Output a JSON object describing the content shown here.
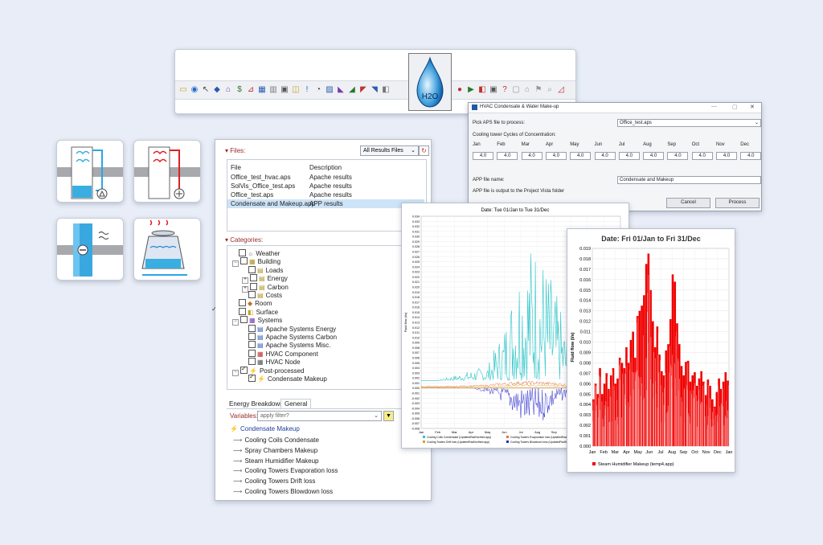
{
  "toolbar": {
    "icons": [
      "open-folder",
      "help",
      "cursor",
      "cube",
      "zone",
      "dollar",
      "chart",
      "table",
      "bar-chart",
      "calculator",
      "results",
      "exclamation",
      "pie",
      "image",
      "chart-a",
      "chart-b",
      "chart-c",
      "chart-d",
      "chart-e"
    ],
    "icons_right": [
      "stop",
      "play",
      "pause",
      "save",
      "question",
      "lock",
      "house",
      "flag",
      "search",
      "ruler"
    ],
    "drop_icon_label": "H2O"
  },
  "symbols": [
    "cooling-coil-icon",
    "heating-coil-icon",
    "steam-humidifier-icon",
    "cooling-tower-icon"
  ],
  "files_panel": {
    "title": "Files:",
    "filter_select": "All Results Files",
    "columns": [
      "File",
      "Description"
    ],
    "rows": [
      {
        "file": "Office_test_hvac.aps",
        "desc": "Apache results"
      },
      {
        "file": "SolVis_Office_test.aps",
        "desc": "Apache results"
      },
      {
        "file": "Office_test.aps",
        "desc": "Apache results"
      },
      {
        "file": "Condensate and Makeup.app",
        "desc": "APP results"
      }
    ],
    "categories_title": "Categories:",
    "tree": [
      {
        "label": "Weather",
        "level": 1,
        "expander": false,
        "checked": false
      },
      {
        "label": "Building",
        "level": 1,
        "expander": true,
        "checked": false
      },
      {
        "label": "Loads",
        "level": 2,
        "expander": false,
        "checked": false
      },
      {
        "label": "Energy",
        "level": 2,
        "expander": true,
        "checked": false
      },
      {
        "label": "Carbon",
        "level": 2,
        "expander": true,
        "checked": false
      },
      {
        "label": "Costs",
        "level": 2,
        "expander": false,
        "checked": false
      },
      {
        "label": "Room",
        "level": 1,
        "expander": false,
        "checked": false
      },
      {
        "label": "Surface",
        "level": 1,
        "expander": false,
        "checked": false
      },
      {
        "label": "Systems",
        "level": 1,
        "expander": true,
        "checked": false
      },
      {
        "label": "Apache Systems Energy",
        "level": 2,
        "expander": false,
        "checked": false
      },
      {
        "label": "Apache Systems Carbon",
        "level": 2,
        "expander": false,
        "checked": false
      },
      {
        "label": "Apache Systems Misc.",
        "level": 2,
        "expander": false,
        "checked": false
      },
      {
        "label": "HVAC Component",
        "level": 2,
        "expander": false,
        "checked": false
      },
      {
        "label": "HVAC Node",
        "level": 2,
        "expander": false,
        "checked": false
      },
      {
        "label": "Post-processed",
        "level": 1,
        "expander": true,
        "checked": true
      },
      {
        "label": "Condensate Makeup",
        "level": 2,
        "expander": false,
        "checked": true
      }
    ],
    "tabs": [
      "Energy Breakdown",
      "General"
    ],
    "variables_label": "Variables:",
    "filter_placeholder": "apply filter?",
    "var_group": "Condensate Makeup",
    "variables": [
      "Cooling Coils Condensate",
      "Spray Chambers Makeup",
      "Steam Humidifier Makeup",
      "Cooling Towers Evaporation loss",
      "Cooling Towers Drift loss",
      "Cooling Towers Blowdown loss"
    ]
  },
  "dialog": {
    "title": "HVAC Condensate & Water Make-up",
    "aps_label": "Pick APS file to process:",
    "aps_value": "Office_test.aps",
    "cycles_label": "Cooling tower Cycles of Concentration:",
    "months": [
      "Jan",
      "Feb",
      "Mar",
      "Apr",
      "May",
      "Jun",
      "Jul",
      "Aug",
      "Sep",
      "Oct",
      "Nov",
      "Dec"
    ],
    "month_values": [
      "4.0",
      "4.0",
      "4.0",
      "4.0",
      "4.0",
      "4.0",
      "4.0",
      "4.0",
      "4.0",
      "4.0",
      "4.0",
      "4.0"
    ],
    "app_label": "APP file name:",
    "app_value": "Condensate and Makeup",
    "note": "APP file is output to the Project Vista folder",
    "cancel": "Cancel",
    "process": "Process"
  },
  "chart_data": [
    {
      "type": "line",
      "title": "Date: Tue 01/Jan to Tue 31/Dec",
      "ylabel": "Fluid flow (l/s)",
      "x": [
        "Jan",
        "Feb",
        "Mar",
        "Apr",
        "May",
        "Jun",
        "Jul",
        "Aug",
        "Sep",
        "Oct",
        "Nov",
        "Dec",
        "Jan"
      ],
      "ylim": [
        -0.008,
        0.034
      ],
      "yticks": [
        "0.034",
        "0.033",
        "0.032",
        "0.031",
        "0.030",
        "0.029",
        "0.028",
        "0.027",
        "0.026",
        "0.025",
        "0.024",
        "0.023",
        "0.022",
        "0.021",
        "0.020",
        "0.019",
        "0.018",
        "0.017",
        "0.016",
        "0.015",
        "0.014",
        "0.013",
        "0.012",
        "0.011",
        "0.010",
        "0.009",
        "0.008",
        "0.007",
        "0.006",
        "0.005",
        "0.004",
        "0.003",
        "0.002",
        "0.001",
        "0.000",
        "-0.001",
        "-0.002",
        "-0.003",
        "-0.004",
        "-0.005",
        "-0.006",
        "-0.007",
        "-0.008"
      ],
      "series": [
        {
          "name": "Cooling Coils Condensate",
          "color": "#2ec5c9",
          "values": [
            0.001,
            0.001,
            0.002,
            0.003,
            0.004,
            0.012,
            0.028,
            0.03,
            0.02,
            0.008,
            0.003,
            0.001,
            0.001
          ]
        },
        {
          "name": "Cooling Towers Blowdown loss",
          "color": "#2a2ad0",
          "values": [
            0.0,
            0.0,
            0.0,
            0.0,
            -0.001,
            -0.003,
            -0.007,
            -0.008,
            -0.004,
            -0.001,
            0.0,
            0.0,
            0.0
          ]
        },
        {
          "name": "Cooling Towers Drift loss",
          "color": "#d9a020",
          "values": [
            0.0002,
            0.0002,
            0.0002,
            0.0003,
            0.0003,
            0.0004,
            0.0005,
            0.0005,
            0.0004,
            0.0003,
            0.0002,
            0.0002,
            0.0002
          ]
        },
        {
          "name": "Cooling Towers Evaporation loss",
          "color": "#e87040",
          "values": [
            0.0003,
            0.0003,
            0.0003,
            0.0004,
            0.0005,
            0.0008,
            0.001,
            0.001,
            0.0008,
            0.0005,
            0.0003,
            0.0003,
            0.0003
          ]
        }
      ],
      "legend_entries": [
        "Cooling Coils Condensate  (UpdatedRadNorthed.app)",
        "Cooling Towers Evaporation loss  (UpdatedRadNorthed.app)",
        "Cooling Towers Drift loss  (UpdatedRadNorthed.app)",
        "Cooling Towers Blowdown loss  (UpdatedRadNorthed.app)"
      ]
    },
    {
      "type": "bar",
      "title": "Date: Fri 01/Jan to Fri 31/Dec",
      "ylabel": "Fluid flow (l/s)",
      "x": [
        "Jan",
        "Feb",
        "Mar",
        "Apr",
        "May",
        "Jun",
        "Jul",
        "Aug",
        "Sep",
        "Oct",
        "Nov",
        "Dec",
        "Jan"
      ],
      "ylim": [
        0,
        0.019
      ],
      "yticks": [
        "0.019",
        "0.018",
        "0.017",
        "0.016",
        "0.015",
        "0.014",
        "0.013",
        "0.012",
        "0.011",
        "0.010",
        "0.009",
        "0.008",
        "0.007",
        "0.006",
        "0.005",
        "0.004",
        "0.003",
        "0.002",
        "0.001",
        "0.000"
      ],
      "series": [
        {
          "name": "Steam Humidifier Makeup",
          "color": "#f00000",
          "values": [
            0.0045,
            0.006,
            0.005,
            0.0075,
            0.005,
            0.006,
            0.007,
            0.0055,
            0.0068,
            0.0075,
            0.006,
            0.0065,
            0.0085,
            0.008,
            0.0075,
            0.0095,
            0.008,
            0.0102,
            0.011,
            0.0085,
            0.0125,
            0.013,
            0.0135,
            0.0145,
            0.0175,
            0.0185,
            0.015,
            0.012,
            0.0095,
            0.0115,
            0.0088,
            0.0072,
            0.0068,
            0.0092,
            0.0098,
            0.0122,
            0.0165,
            0.0158,
            0.0118,
            0.0098,
            0.0077,
            0.0068,
            0.0081,
            0.0082,
            0.0062,
            0.0068,
            0.0071,
            0.0058,
            0.0065,
            0.0072,
            0.0062,
            0.0049,
            0.0064,
            0.0058,
            0.0045,
            0.0038,
            0.0052,
            0.0065,
            0.0055,
            0.0062,
            0.0071,
            0.0063
          ]
        }
      ],
      "legend_entries": [
        "Steam Humidifier Makeup   (temp4.app)"
      ]
    }
  ]
}
